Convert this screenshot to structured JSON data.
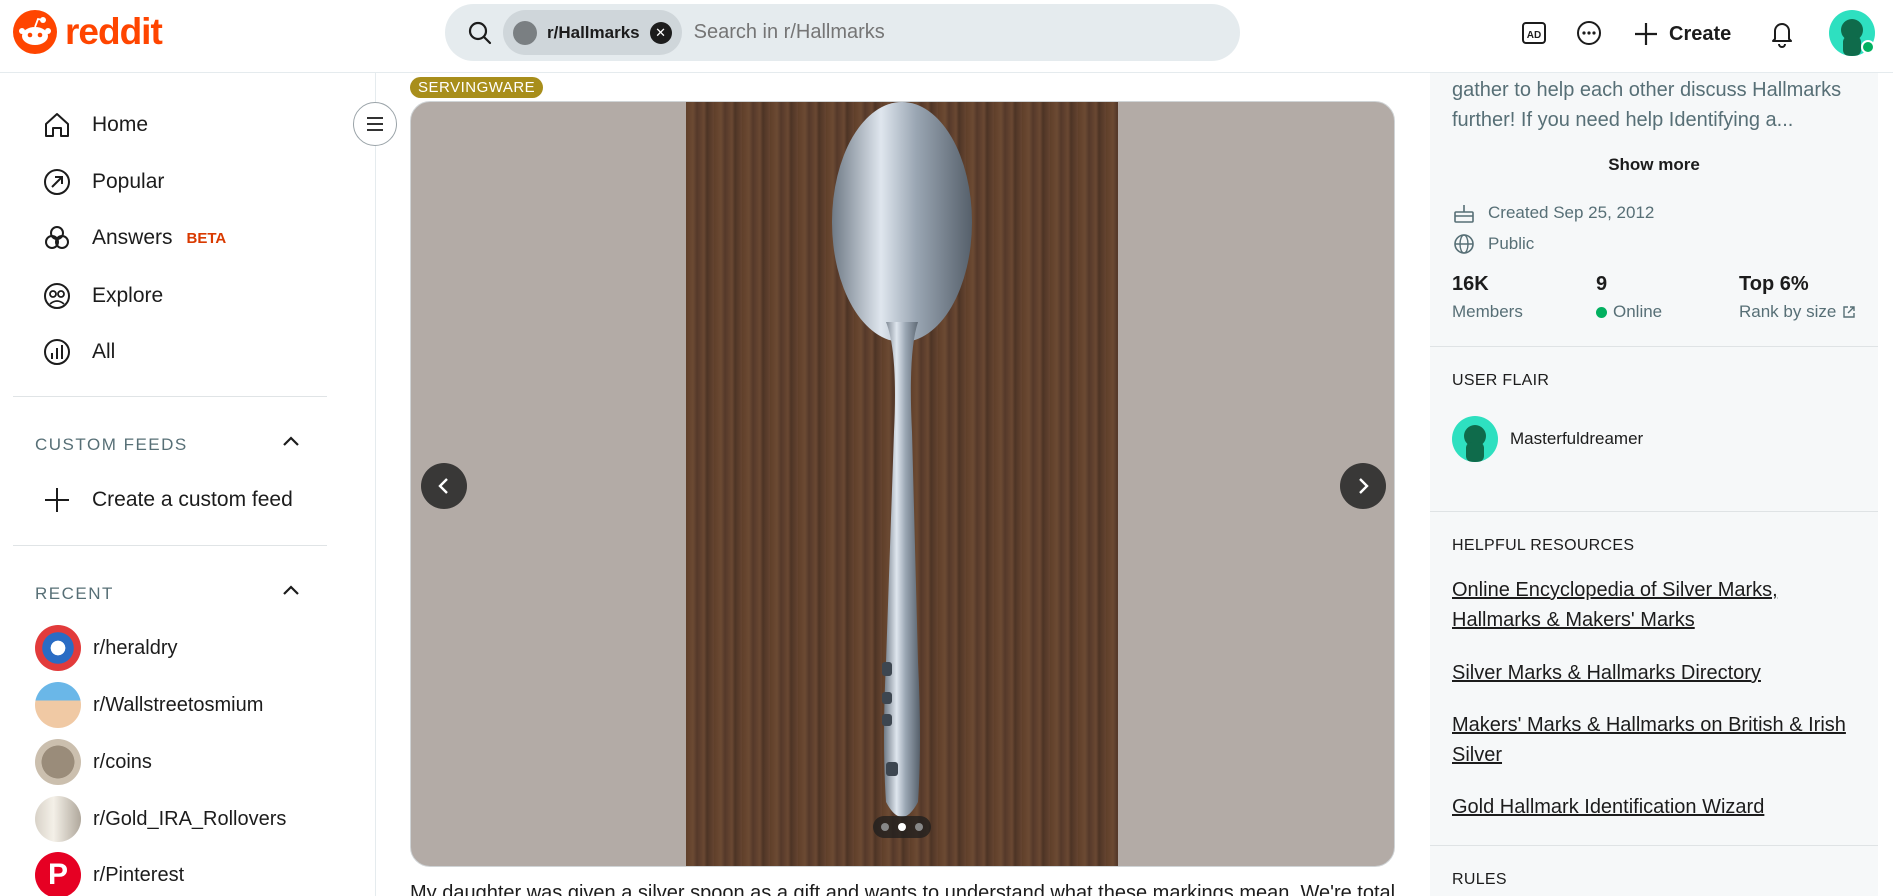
{
  "header": {
    "logo_text": "reddit",
    "search": {
      "chip_label": "r/Hallmarks",
      "placeholder": "Search in r/Hallmarks"
    },
    "create_label": "Create",
    "icons": [
      "advertise-icon",
      "chat-icon",
      "plus-icon",
      "bell-icon"
    ]
  },
  "sidebar": {
    "nav": [
      {
        "label": "Home",
        "icon": "home-icon"
      },
      {
        "label": "Popular",
        "icon": "popular-icon"
      },
      {
        "label": "Answers",
        "icon": "answers-icon",
        "badge": "BETA"
      },
      {
        "label": "Explore",
        "icon": "explore-icon"
      },
      {
        "label": "All",
        "icon": "all-icon"
      }
    ],
    "custom_feeds": {
      "title": "CUSTOM FEEDS",
      "create_label": "Create a custom feed"
    },
    "recent": {
      "title": "RECENT",
      "items": [
        {
          "label": "r/heraldry"
        },
        {
          "label": "r/Wallstreetosmium"
        },
        {
          "label": "r/coins"
        },
        {
          "label": "r/Gold_IRA_Rollovers"
        },
        {
          "label": "r/Pinterest"
        }
      ]
    }
  },
  "post": {
    "flair": "SERVINGWARE",
    "gallery": {
      "image_count": 3,
      "active_index": 1
    },
    "body_preview": "My daughter was given a silver spoon as a gift and wants to understand what these markings mean. We're totally"
  },
  "right_sidebar": {
    "description": "gather to help each other discuss Hallmarks further! If you need help Identifying a...",
    "show_more": "Show more",
    "created": "Created Sep 25, 2012",
    "visibility": "Public",
    "stats": [
      {
        "value": "16K",
        "label": "Members"
      },
      {
        "value": "9",
        "label": "Online"
      },
      {
        "value": "Top 6%",
        "label": "Rank by size"
      }
    ],
    "user_flair": {
      "title": "USER FLAIR",
      "username": "Masterfuldreamer"
    },
    "resources": {
      "title": "HELPFUL RESOURCES",
      "links": [
        "Online Encyclopedia of Silver Marks, Hallmarks & Makers' Marks",
        "Silver Marks & Hallmarks Directory",
        "Makers' Marks & Hallmarks on British & Irish Silver",
        "Gold Hallmark Identification Wizard"
      ]
    },
    "rules_title": "RULES"
  },
  "colors": {
    "brand": "#ff4500",
    "flair": "#a88e1b",
    "online": "#02b060"
  }
}
